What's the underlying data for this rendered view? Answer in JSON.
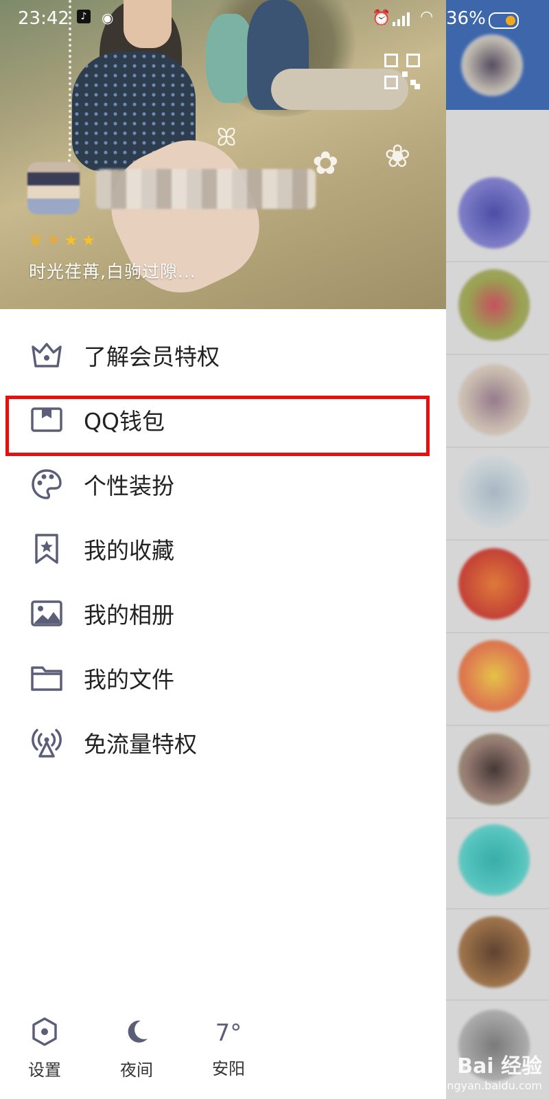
{
  "status_bar": {
    "time": "23:42",
    "battery": "36%"
  },
  "profile": {
    "signature": "时光荏苒,白驹过隙..."
  },
  "menu": [
    {
      "label": "了解会员特权",
      "icon": "crown-icon"
    },
    {
      "label": "QQ钱包",
      "icon": "wallet-icon"
    },
    {
      "label": "个性装扮",
      "icon": "palette-icon"
    },
    {
      "label": "我的收藏",
      "icon": "bookmark-star-icon"
    },
    {
      "label": "我的相册",
      "icon": "photo-icon"
    },
    {
      "label": "我的文件",
      "icon": "folder-icon"
    },
    {
      "label": "免流量特权",
      "icon": "broadcast-icon"
    }
  ],
  "bottom_bar": {
    "settings": "设置",
    "night": "夜间",
    "temperature": "7°",
    "city": "安阳"
  },
  "colors": {
    "highlight_border": "#e3110f",
    "icon": "#5b5e78",
    "chat_header": "#3e67ab"
  },
  "watermark": {
    "brand": "Bai 经验",
    "url": "jingyan.baidu.com"
  }
}
